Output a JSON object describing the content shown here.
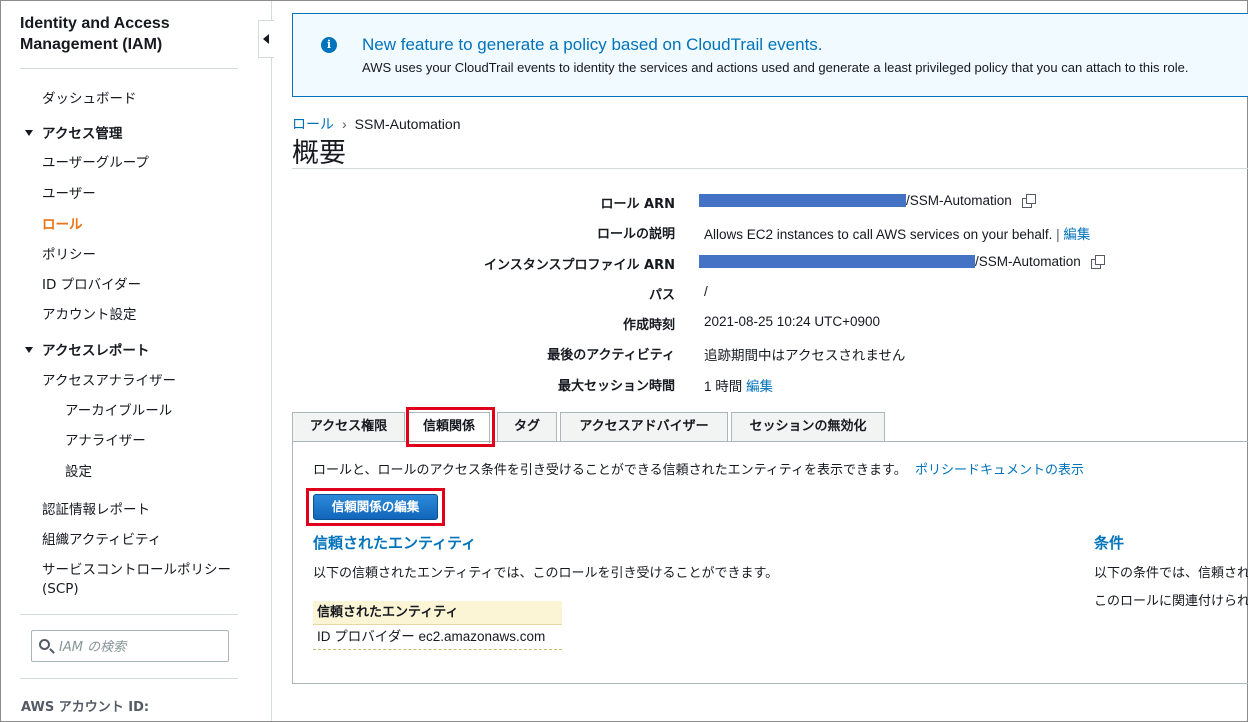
{
  "sidebar": {
    "title": "Identity and Access Management (IAM)",
    "dashboard": "ダッシュボード",
    "access_management": {
      "label": "アクセス管理",
      "items": [
        "ユーザーグループ",
        "ユーザー",
        "ロール",
        "ポリシー",
        "ID プロバイダー",
        "アカウント設定"
      ],
      "active_index": 2
    },
    "access_reports": {
      "label": "アクセスレポート",
      "analyzer": "アクセスアナライザー",
      "analyzer_items": [
        "アーカイブルール",
        "アナライザー",
        "設定"
      ],
      "items": [
        "認証情報レポート",
        "組織アクティビティ",
        "サービスコントロールポリシー (SCP)"
      ]
    },
    "search_placeholder": "IAM の検索",
    "account_id_label": "AWS アカウント ID:"
  },
  "banner": {
    "icon": "info-icon",
    "title": "New feature to generate a policy based on CloudTrail events.",
    "body": "AWS uses your CloudTrail events to identity the services and actions used and generate a least privileged policy that you can attach to this role."
  },
  "breadcrumb": {
    "parent": "ロール",
    "current": "SSM-Automation"
  },
  "page_title": "概要",
  "summary": {
    "role_arn_label": "ロール ARN",
    "role_arn_suffix": "/SSM-Automation",
    "description_label": "ロールの説明",
    "description_value": "Allows EC2 instances to call AWS services on your behalf.",
    "description_sep": " | ",
    "edit_label": "編集",
    "instance_profile_label": "インスタンスプロファイル ARN",
    "instance_profile_suffix": "/SSM-Automation",
    "path_label": "パス",
    "path_value": "/",
    "created_label": "作成時刻",
    "created_value": "2021-08-25 10:24 UTC+0900",
    "last_activity_label": "最後のアクティビティ",
    "last_activity_value": "追跡期間中はアクセスされません",
    "max_session_label": "最大セッション時間",
    "max_session_value": "1 時間",
    "max_session_edit": "編集",
    "redaction_color": "#4472c4"
  },
  "tabs": [
    "アクセス権限",
    "信頼関係",
    "タグ",
    "アクセスアドバイザー",
    "セッションの無効化"
  ],
  "active_tab": 1,
  "trust": {
    "description": "ロールと、ロールのアクセス条件を引き受けることができる信頼されたエンティティを表示できます。",
    "policy_link": "ポリシードキュメントの表示",
    "edit_button": "信頼関係の編集",
    "entities_title": "信頼されたエンティティ",
    "entities_desc": "以下の信頼されたエンティティでは、このロールを引き受けることができます。",
    "table_header": "信頼されたエンティティ",
    "table_rows": [
      "ID プロバイダー ec2.amazonaws.com"
    ],
    "conditions_title": "条件",
    "conditions_line1": "以下の条件では、信頼され",
    "conditions_line2": "このロールに関連付けられ"
  },
  "colors": {
    "accent_link": "#0073bb",
    "active_nav": "#ec7211",
    "highlight_box": "#e0001b",
    "primary_button": "#1166bb"
  }
}
